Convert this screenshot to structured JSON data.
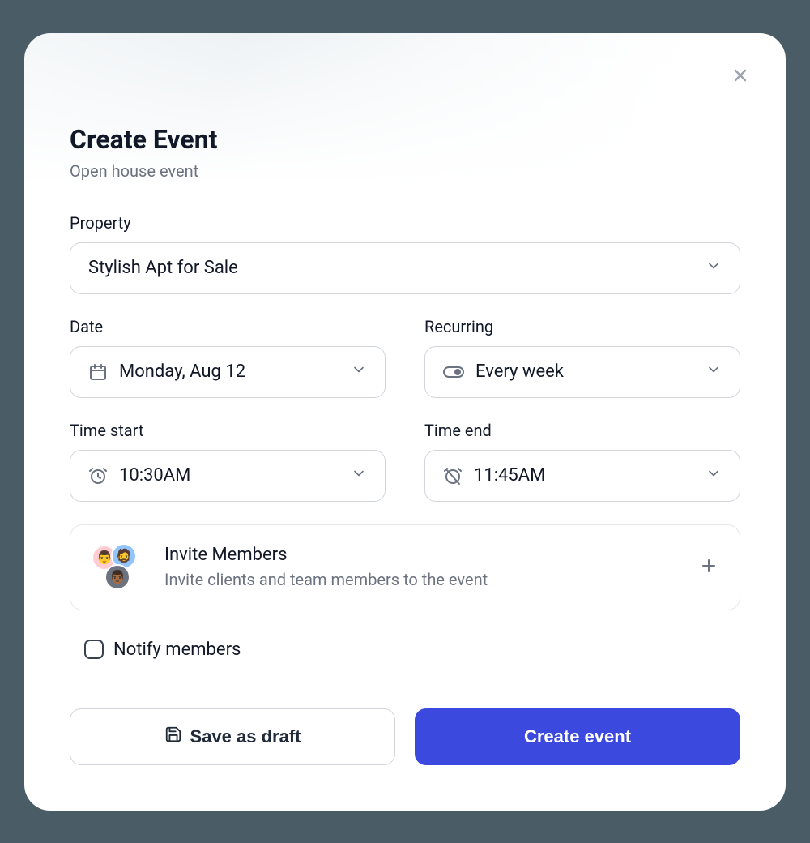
{
  "modal": {
    "title": "Create Event",
    "subtitle": "Open house event"
  },
  "form": {
    "property": {
      "label": "Property",
      "value": "Stylish Apt for Sale"
    },
    "date": {
      "label": "Date",
      "value": "Monday, Aug 12"
    },
    "recurring": {
      "label": "Recurring",
      "value": "Every week"
    },
    "time_start": {
      "label": "Time start",
      "value": "10:30AM"
    },
    "time_end": {
      "label": "Time end",
      "value": "11:45AM"
    }
  },
  "invite": {
    "title": "Invite Members",
    "description": "Invite clients and team members to the event"
  },
  "notify": {
    "label": "Notify members",
    "checked": false
  },
  "footer": {
    "save_draft": "Save as draft",
    "create": "Create event"
  }
}
